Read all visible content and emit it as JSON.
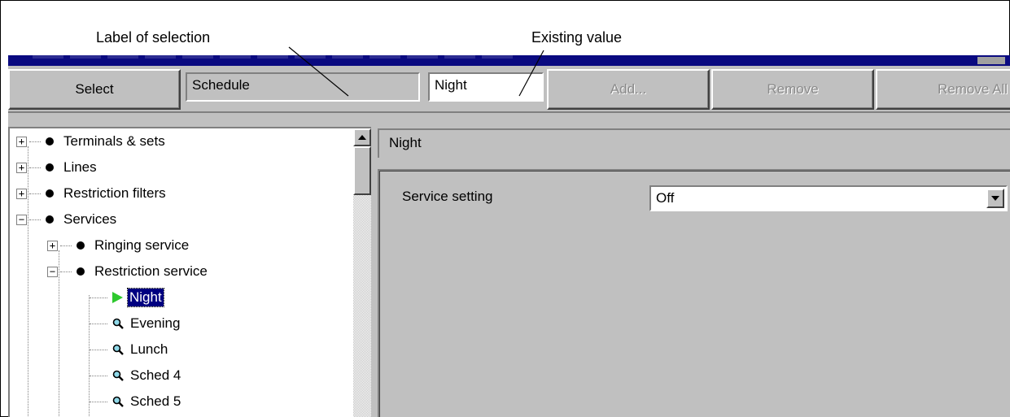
{
  "callouts": {
    "label_of_selection": "Label of selection",
    "existing_value": "Existing value"
  },
  "toolbar": {
    "select_label": "Select",
    "label_field_value": "Schedule",
    "value_field_value": "Night",
    "add_label": "Add...",
    "remove_label": "Remove",
    "remove_all_label": "Remove All"
  },
  "tree": {
    "items": [
      {
        "label": "Terminals & sets",
        "expander": "+",
        "icon": "bullet-icon"
      },
      {
        "label": "Lines",
        "expander": "+",
        "icon": "bullet-icon"
      },
      {
        "label": "Restriction filters",
        "expander": "+",
        "icon": "bullet-icon"
      },
      {
        "label": "Services",
        "expander": "−",
        "icon": "bullet-icon"
      },
      {
        "label": "Ringing service",
        "expander": "+",
        "icon": "bullet-icon"
      },
      {
        "label": "Restriction service",
        "expander": "−",
        "icon": "bullet-icon"
      },
      {
        "label": "Night",
        "icon": "play-icon",
        "selected": true
      },
      {
        "label": "Evening",
        "icon": "magnifier-icon"
      },
      {
        "label": "Lunch",
        "icon": "magnifier-icon"
      },
      {
        "label": "Sched 4",
        "icon": "magnifier-icon"
      },
      {
        "label": "Sched 5",
        "icon": "magnifier-icon"
      }
    ]
  },
  "detail": {
    "header": "Night",
    "service_setting_label": "Service setting",
    "service_setting_value": "Off"
  },
  "colors": {
    "window_face": "#c0c0c0",
    "title_bar": "#0a0a80",
    "selection": "#000080",
    "play_icon": "#2ec82e"
  }
}
